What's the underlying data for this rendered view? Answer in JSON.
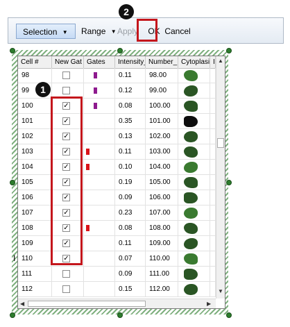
{
  "toolbar": {
    "selection_label": "Selection",
    "range_label": "Range",
    "apply_label": "Apply",
    "ok_label": "OK",
    "cancel_label": "Cancel"
  },
  "callouts": {
    "one": "1",
    "two": "2"
  },
  "grid": {
    "columns": [
      "Cell #",
      "New Gat",
      "Gates",
      "Intensity_",
      "Number_",
      "Cytoplasi",
      "I"
    ],
    "rows": [
      {
        "cell": "98",
        "checked": false,
        "gate": "purple",
        "intensity": "0.11",
        "number": "98.00"
      },
      {
        "cell": "99",
        "checked": false,
        "gate": "purple",
        "intensity": "0.12",
        "number": "99.00"
      },
      {
        "cell": "100",
        "checked": true,
        "gate": "purple",
        "intensity": "0.08",
        "number": "100.00"
      },
      {
        "cell": "101",
        "checked": true,
        "gate": "",
        "intensity": "0.35",
        "number": "101.00"
      },
      {
        "cell": "102",
        "checked": true,
        "gate": "",
        "intensity": "0.13",
        "number": "102.00"
      },
      {
        "cell": "103",
        "checked": true,
        "gate": "red",
        "intensity": "0.11",
        "number": "103.00"
      },
      {
        "cell": "104",
        "checked": true,
        "gate": "red",
        "intensity": "0.10",
        "number": "104.00"
      },
      {
        "cell": "105",
        "checked": true,
        "gate": "",
        "intensity": "0.19",
        "number": "105.00"
      },
      {
        "cell": "106",
        "checked": true,
        "gate": "",
        "intensity": "0.09",
        "number": "106.00"
      },
      {
        "cell": "107",
        "checked": true,
        "gate": "",
        "intensity": "0.23",
        "number": "107.00"
      },
      {
        "cell": "108",
        "checked": true,
        "gate": "red",
        "intensity": "0.08",
        "number": "108.00"
      },
      {
        "cell": "109",
        "checked": true,
        "gate": "",
        "intensity": "0.11",
        "number": "109.00"
      },
      {
        "cell": "110",
        "checked": true,
        "gate": "",
        "intensity": "0.07",
        "number": "110.00"
      },
      {
        "cell": "111",
        "checked": false,
        "gate": "",
        "intensity": "0.09",
        "number": "111.00"
      },
      {
        "cell": "112",
        "checked": false,
        "gate": "",
        "intensity": "0.15",
        "number": "112.00"
      }
    ]
  },
  "colors": {
    "highlight": "#c4161c",
    "gate_purple": "#8e1a8e",
    "gate_red": "#d9141a",
    "selection_hatch": "#7fb07f"
  }
}
